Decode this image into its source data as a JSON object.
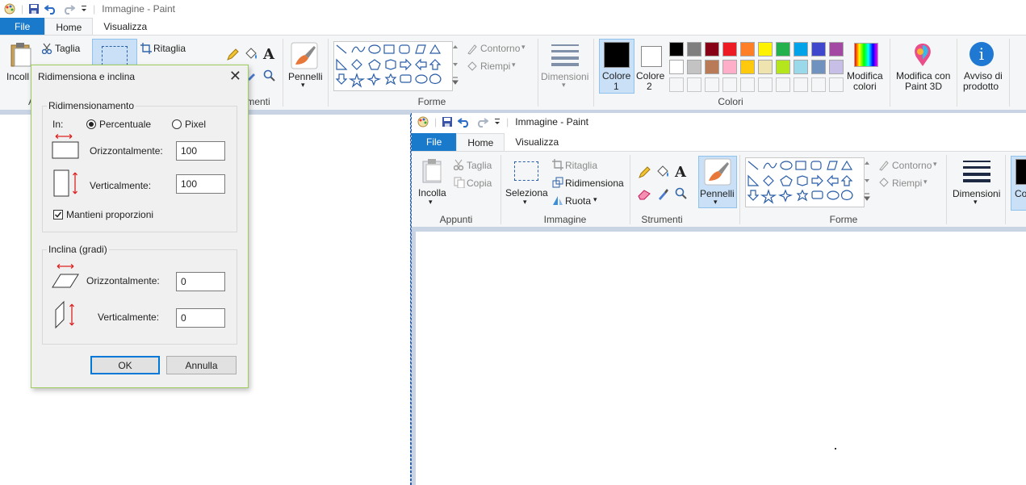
{
  "back": {
    "title": "Immagine - Paint",
    "tabs": [
      "File",
      "Home",
      "Visualizza"
    ],
    "clipboard": {
      "paste": "Incoll",
      "cut": "Taglia",
      "group": "A"
    },
    "image": {
      "crop": "Ritaglia"
    },
    "tools_group": "menti",
    "brushes": "Pennelli",
    "shapes": {
      "outline": "Contorno",
      "fill": "Riempi",
      "group": "Forme"
    },
    "size": "Dimensioni",
    "color1": [
      "Colore",
      "1"
    ],
    "color2": [
      "Colore",
      "2"
    ],
    "colors_group": "Colori",
    "edit_colors": [
      "Modifica",
      "colori"
    ],
    "paint3d": [
      "Modifica con",
      "Paint 3D"
    ],
    "product_alert": [
      "Avviso di",
      "prodotto"
    ],
    "palette_row1": [
      "#000000",
      "#7f7f7f",
      "#880015",
      "#ed1c24",
      "#ff7f27",
      "#fff200",
      "#22b14c",
      "#00a2e8",
      "#3f48cc",
      "#a349a4"
    ],
    "palette_row2": [
      "#ffffff",
      "#c3c3c3",
      "#b97a57",
      "#ffaec9",
      "#ffc90e",
      "#efe4b0",
      "#b5e61d",
      "#99d9ea",
      "#7092be",
      "#c8bfe7"
    ]
  },
  "front": {
    "title": "Immagine - Paint",
    "tabs": [
      "File",
      "Home",
      "Visualizza"
    ],
    "clipboard": {
      "paste": "Incolla",
      "cut": "Taglia",
      "copy": "Copia",
      "group": "Appunti"
    },
    "image": {
      "select": "Seleziona",
      "crop": "Ritaglia",
      "resize": "Ridimensiona",
      "rotate": "Ruota",
      "group": "Immagine"
    },
    "tools_group": "Strumenti",
    "brushes": "Pennelli",
    "shapes": {
      "outline": "Contorno",
      "fill": "Riempi",
      "group": "Forme"
    },
    "size": "Dimensioni",
    "color1": "Co"
  },
  "dialog": {
    "title": "Ridimensiona e inclina",
    "close": "✕",
    "resize_group": "Ridimensionamento",
    "in_label": "In:",
    "percent": "Percentuale",
    "pixel": "Pixel",
    "horizontal": "Orizzontalmente:",
    "vertical": "Verticalmente:",
    "resize_h": "100",
    "resize_v": "100",
    "keep_ratio": "Mantieni proporzioni",
    "skew_group": "Inclina (gradi)",
    "skew_h": "0",
    "skew_v": "0",
    "ok": "OK",
    "cancel": "Annulla"
  }
}
